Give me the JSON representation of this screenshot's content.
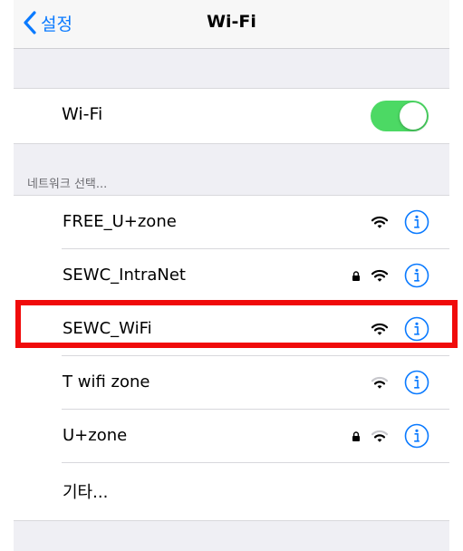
{
  "navbar": {
    "back_label": "설정",
    "title": "Wi-Fi"
  },
  "wifi_toggle": {
    "label": "Wi-Fi",
    "state": "on",
    "color": "#4cd964"
  },
  "network_section": {
    "header": "네트워크 선택...",
    "networks": [
      {
        "name": "FREE_U+zone",
        "locked": false,
        "signal": 3
      },
      {
        "name": "SEWC_IntraNet",
        "locked": true,
        "signal": 3
      },
      {
        "name": "SEWC_WiFi",
        "locked": false,
        "signal": 3,
        "highlighted": true
      },
      {
        "name": "T wifi zone",
        "locked": false,
        "signal": 2
      },
      {
        "name": "U+zone",
        "locked": true,
        "signal": 2
      }
    ],
    "other_label": "기타..."
  },
  "colors": {
    "accent": "#0a7aff",
    "highlight": "#f00b0b",
    "background": "#efeff4"
  }
}
